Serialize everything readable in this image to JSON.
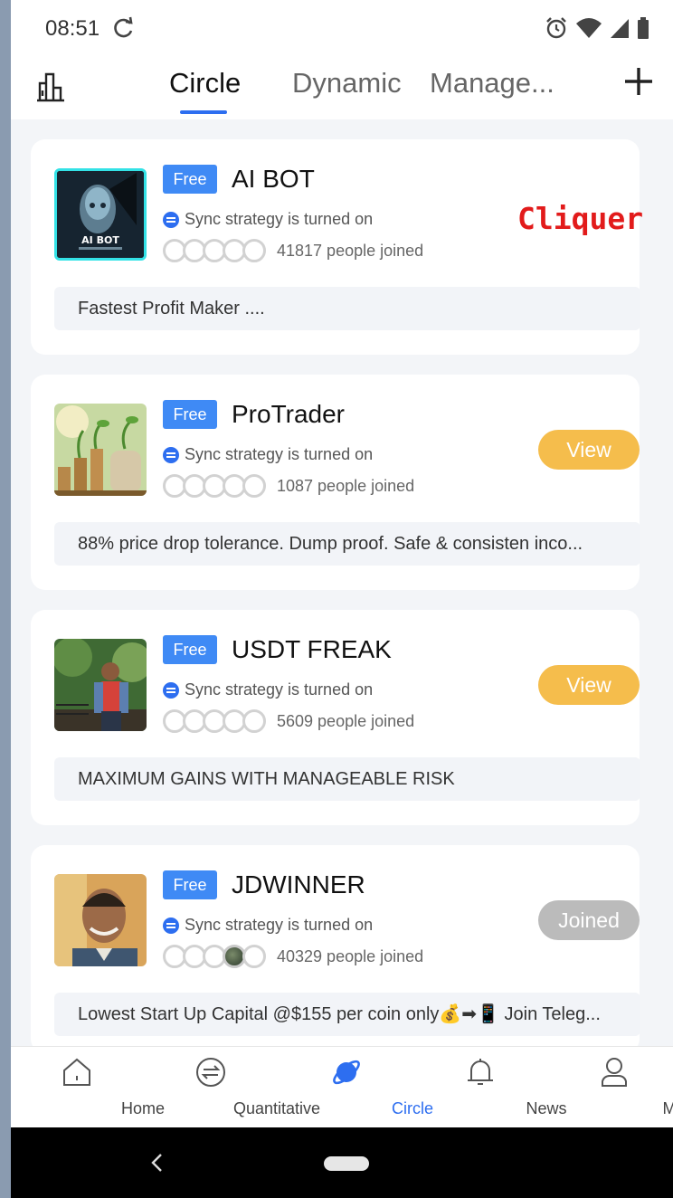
{
  "status_bar": {
    "time": "08:51",
    "icons": [
      "sync-icon",
      "alarm-icon",
      "wifi-icon",
      "signal-icon",
      "battery-icon"
    ]
  },
  "top_nav": {
    "tabs": [
      {
        "label": "Circle",
        "active": true
      },
      {
        "label": "Dynamic",
        "active": false
      },
      {
        "label": "Manage...",
        "active": false
      }
    ],
    "left_icon": "bar-chart-icon",
    "right_icon": "plus-icon"
  },
  "overlay_annotation": "Cliquer",
  "cards": [
    {
      "badge": "Free",
      "title": "AI BOT",
      "sync_text": "Sync strategy is turned on",
      "joined_text": "41817 people joined",
      "description": "Fastest Profit Maker ....",
      "button": "",
      "avatar_caption": "AI BOT"
    },
    {
      "badge": "Free",
      "title": "ProTrader",
      "sync_text": "Sync strategy is turned on",
      "joined_text": "1087 people joined",
      "description": "88% price drop tolerance. Dump proof. Safe & consisten inco...",
      "button": "View"
    },
    {
      "badge": "Free",
      "title": "USDT FREAK",
      "sync_text": "Sync strategy is turned on",
      "joined_text": "5609 people joined",
      "description": "MAXIMUM GAINS WITH MANAGEABLE RISK",
      "button": "View"
    },
    {
      "badge": "Free",
      "title": "JDWINNER",
      "sync_text": "Sync strategy is turned on",
      "joined_text": "40329 people joined",
      "description": "Lowest Start Up Capital @$155 per coin only💰➡📱 Join Teleg...",
      "button": "Joined"
    }
  ],
  "bottom_nav": {
    "items": [
      {
        "label": "Home",
        "icon": "home-icon"
      },
      {
        "label": "Quantitative",
        "icon": "exchange-icon"
      },
      {
        "label": "Circle",
        "icon": "planet-icon",
        "active": true
      },
      {
        "label": "News",
        "icon": "bell-icon"
      },
      {
        "label": "Mine",
        "icon": "user-icon"
      }
    ]
  },
  "colors": {
    "accent": "#2d6ef0",
    "badge": "#3f8af5",
    "view_button": "#f5bd4c",
    "joined_button": "#bbbbbb",
    "annotation": "#e21b1b"
  }
}
